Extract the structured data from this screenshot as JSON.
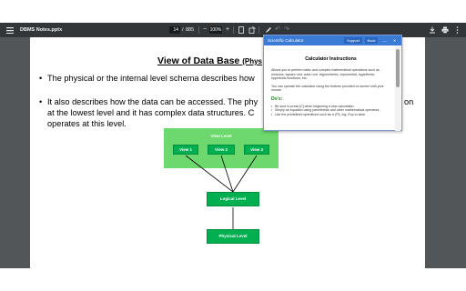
{
  "toolbar": {
    "menu_icon": "hamburger-menu-icon",
    "file_name": "DBMS Notes.pptx",
    "page_current": "14",
    "page_separator": "/",
    "page_total": "885",
    "zoom_out": "−",
    "zoom_value": "100%",
    "zoom_in": "+",
    "icons": [
      "fit-page-icon",
      "rotate-icon",
      "annotate-icon",
      "undo-icon",
      "redo-icon",
      "download-icon",
      "print-icon",
      "more-icon"
    ]
  },
  "slide": {
    "title_main": "View of Data Base ",
    "title_paren": "(Phys",
    "bullet1": "The physical or the internal level schema describes how",
    "bullet2_line1": "It also describes how the data can be accessed. The phy",
    "bullet2_tail": "on",
    "bullet2_line2": "at the lowest level and it has complex data structures. C",
    "bullet2_line3": "operates at this level.",
    "bullet_symbol": "•"
  },
  "diagram": {
    "view_level": "View Level",
    "views": [
      "View 1",
      "View 2",
      "View 3"
    ],
    "logical_level": "Logical Level",
    "physical_level": "Physical Level"
  },
  "calculator": {
    "title": "Scientific Calculator",
    "support": "Support",
    "back": "Back",
    "minimize": "—",
    "close": "✕",
    "heading": "Calculator Instructions",
    "intro1": "Allows you to perform basic and complex mathematical operations such as modulus, square root, cube root, trigonometric, exponential, logarithmic, hyperbolic functions, etc.",
    "intro2": "You can operate the calculator using the buttons provided on screen with your mouse.",
    "dos_heading": "Do's:",
    "dos": [
      "Be sure to press [C] when beginning a new calculation.",
      "Simply an equation using parenthesis and other mathematical operators.",
      "Use the predefined operations such as π (Pi), log, Exp to save"
    ]
  },
  "colors": {
    "toolbar_bg": "#323639",
    "gutter_bg": "#525659",
    "calc_title_bg": "#3a7bd5",
    "diagram_light": "#6dd86d",
    "diagram_box": "#00b050"
  }
}
